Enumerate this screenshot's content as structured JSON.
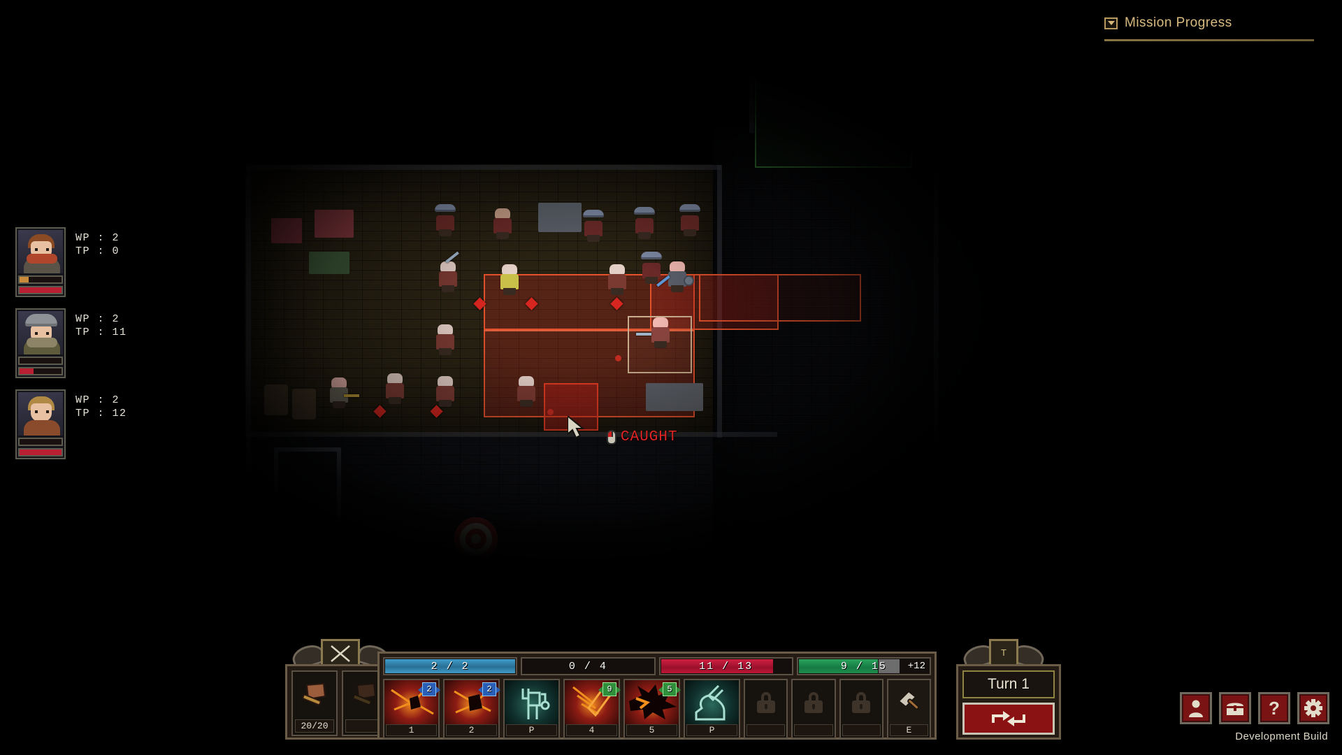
{
  "mission": {
    "title": "Mission Progress",
    "chevron_icon": "chevron-down-icon",
    "accent_color": "#d9bb80"
  },
  "party": [
    {
      "portrait_icon": "portrait-redhead-scarf",
      "wp_label": "WP : 2",
      "tp_label": "TP : 0",
      "bar_top_pct": 22,
      "bar_top_color": "#c98a3a",
      "bar_bottom_pct": 100,
      "bar_bottom_color": "#b81f33"
    },
    {
      "portrait_icon": "portrait-helmet-soldier",
      "wp_label": "WP : 2",
      "tp_label": "TP : 11",
      "bar_top_pct": 0,
      "bar_top_color": "#c98a3a",
      "bar_bottom_pct": 34,
      "bar_bottom_color": "#b81f33"
    },
    {
      "portrait_icon": "portrait-blonde-coat",
      "wp_label": "WP : 2",
      "tp_label": "TP : 12",
      "bar_top_pct": 0,
      "bar_top_color": "#c98a3a",
      "bar_bottom_pct": 100,
      "bar_bottom_color": "#b81f33"
    }
  ],
  "world": {
    "cursor_icon": "mouse-cursor-arrow",
    "tooltip": {
      "mouse_icon": "mouse-left-click-icon",
      "text": "CAUGHT",
      "color": "#e02424"
    }
  },
  "hud": {
    "ornament_icon": "crossed-swords-icon",
    "turn_ornament_icon": "turn-marker-icon",
    "weapons": [
      {
        "icon": "cleaver-weapon-icon",
        "durability": "20/20",
        "equipped": true
      },
      {
        "icon": "cleaver-weapon-icon",
        "durability": "",
        "equipped": false
      }
    ],
    "stats": [
      {
        "name": "action-points",
        "text": "2 / 2",
        "fill_pct": 100,
        "color": "#2f82ad",
        "bonus": ""
      },
      {
        "name": "secondary-points",
        "text": "0 / 4",
        "fill_pct": 0,
        "color": "#7a2030",
        "bonus": ""
      },
      {
        "name": "health",
        "text": "11 / 13",
        "fill_pct": 85,
        "color": "#c01736",
        "bonus": ""
      },
      {
        "name": "stamina",
        "text": "9 / 15",
        "fill_pct": 60,
        "color": "#1f8f4e",
        "bonus": "+12",
        "segment_pct": 18
      }
    ],
    "abilities": [
      {
        "icon": "slash-burst-icon",
        "label": "1",
        "cost": "2",
        "cost_type": "blue",
        "art": "art-red",
        "locked": false
      },
      {
        "icon": "impact-burst-icon",
        "label": "2",
        "cost": "2",
        "cost_type": "blue",
        "art": "art-red",
        "locked": false
      },
      {
        "icon": "surrender-hands-icon",
        "label": "P",
        "cost": "",
        "cost_type": "",
        "art": "art-teal",
        "locked": false
      },
      {
        "icon": "stab-knife-icon",
        "label": "4",
        "cost": "9",
        "cost_type": "green",
        "art": "art-red",
        "locked": false
      },
      {
        "icon": "explosion-icon",
        "label": "5",
        "cost": "5",
        "cost_type": "green",
        "art": "art-red",
        "locked": false
      },
      {
        "icon": "crouch-sneak-icon",
        "label": "P",
        "cost": "",
        "cost_type": "",
        "art": "art-teal",
        "locked": false
      },
      {
        "icon": "lock-icon",
        "label": "",
        "cost": "",
        "cost_type": "",
        "art": "",
        "locked": true
      },
      {
        "icon": "lock-icon",
        "label": "",
        "cost": "",
        "cost_type": "",
        "art": "",
        "locked": true
      },
      {
        "icon": "lock-icon",
        "label": "",
        "cost": "",
        "cost_type": "",
        "art": "",
        "locked": true
      },
      {
        "icon": "hammer-tool-icon",
        "label": "E",
        "cost": "",
        "cost_type": "",
        "art": "",
        "locked": false
      }
    ],
    "turn": {
      "label": "Turn 1",
      "end_turn_icon": "end-turn-loop-icon",
      "marker": "T"
    },
    "system_buttons": [
      {
        "icon": "character-icon",
        "name": "character-button"
      },
      {
        "icon": "chest-icon",
        "name": "inventory-button"
      },
      {
        "icon": "question-icon",
        "name": "help-button"
      },
      {
        "icon": "gear-icon",
        "name": "settings-button"
      }
    ],
    "build_text": "Development Build"
  }
}
